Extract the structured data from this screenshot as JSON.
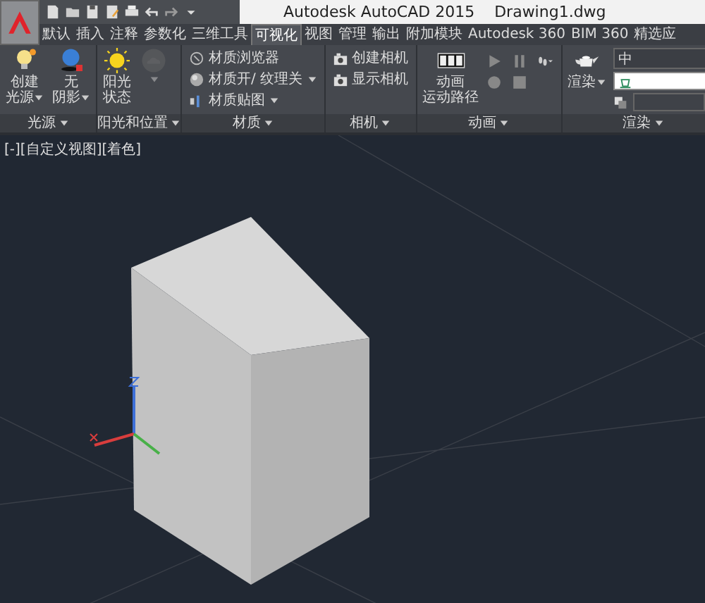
{
  "window": {
    "title": "Autodesk AutoCAD 2015    Drawing1.dwg"
  },
  "tabs": [
    {
      "label": "默认",
      "selected": false
    },
    {
      "label": "插入",
      "selected": false
    },
    {
      "label": "注释",
      "selected": false
    },
    {
      "label": "参数化",
      "selected": false
    },
    {
      "label": "三维工具",
      "selected": false
    },
    {
      "label": "可视化",
      "selected": true
    },
    {
      "label": "视图",
      "selected": false
    },
    {
      "label": "管理",
      "selected": false
    },
    {
      "label": "输出",
      "selected": false
    },
    {
      "label": "附加模块",
      "selected": false
    },
    {
      "label": "Autodesk 360",
      "selected": false
    },
    {
      "label": "BIM 360",
      "selected": false
    },
    {
      "label": "精选应",
      "selected": false
    }
  ],
  "panels": [
    {
      "title": "光源",
      "items": [
        {
          "kind": "big",
          "lines": [
            "创建",
            "光源"
          ],
          "caret": true,
          "disabled": false
        },
        {
          "kind": "big",
          "lines": [
            "无",
            "阴影"
          ],
          "caret": true,
          "disabled": false
        }
      ]
    },
    {
      "title": "阳光和位置",
      "items": [
        {
          "kind": "big",
          "lines": [
            "阳光",
            "状态"
          ],
          "caret": false,
          "disabled": false
        },
        {
          "kind": "big",
          "caret": true,
          "disabled": true
        }
      ]
    },
    {
      "title": "材质",
      "items": [
        {
          "kind": "small",
          "label": "材质浏览器",
          "caret": false
        },
        {
          "kind": "small",
          "label": "材质开/ 纹理关",
          "caret": true
        },
        {
          "kind": "small",
          "label": "材质贴图",
          "caret": true
        }
      ]
    },
    {
      "title": "相机",
      "items": [
        {
          "kind": "small",
          "label": "创建相机",
          "caret": false
        },
        {
          "kind": "small",
          "label": "显示相机",
          "caret": false
        }
      ]
    },
    {
      "title": "动画",
      "items": [
        {
          "kind": "big",
          "lines": [
            "动画",
            "运动路径"
          ],
          "caret": false,
          "disabled": false
        },
        {
          "kind": "controls"
        }
      ]
    },
    {
      "title": "渲染",
      "items": [
        {
          "kind": "big",
          "lines": [
            "渲染"
          ],
          "caret": true,
          "disabled": false
        },
        {
          "kind": "render",
          "preset": "中"
        }
      ]
    }
  ],
  "viewport": {
    "label": "[-][自定义视图][着色]"
  }
}
